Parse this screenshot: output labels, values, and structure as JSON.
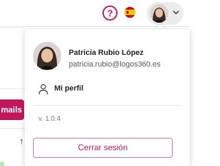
{
  "header": {
    "help_label": "?",
    "language_flag": "spain-flag-icon",
    "user_chip": {
      "avatar": "user-avatar",
      "chevron": "chevron-down-icon"
    }
  },
  "background": {
    "emails_button_label": "mails",
    "sort_icon": "↑"
  },
  "user_menu": {
    "name": "Patricia Rubio López",
    "email": "patricia.rubio@logos360.es",
    "items": [
      {
        "icon": "user-icon",
        "label": "Mi perfil"
      }
    ],
    "version": "v. 1.0.4",
    "logout_label": "Cerrar sesión"
  },
  "colors": {
    "accent": "#c2185b",
    "logout_border": "#d6769b",
    "chip_bg": "#ececec"
  }
}
